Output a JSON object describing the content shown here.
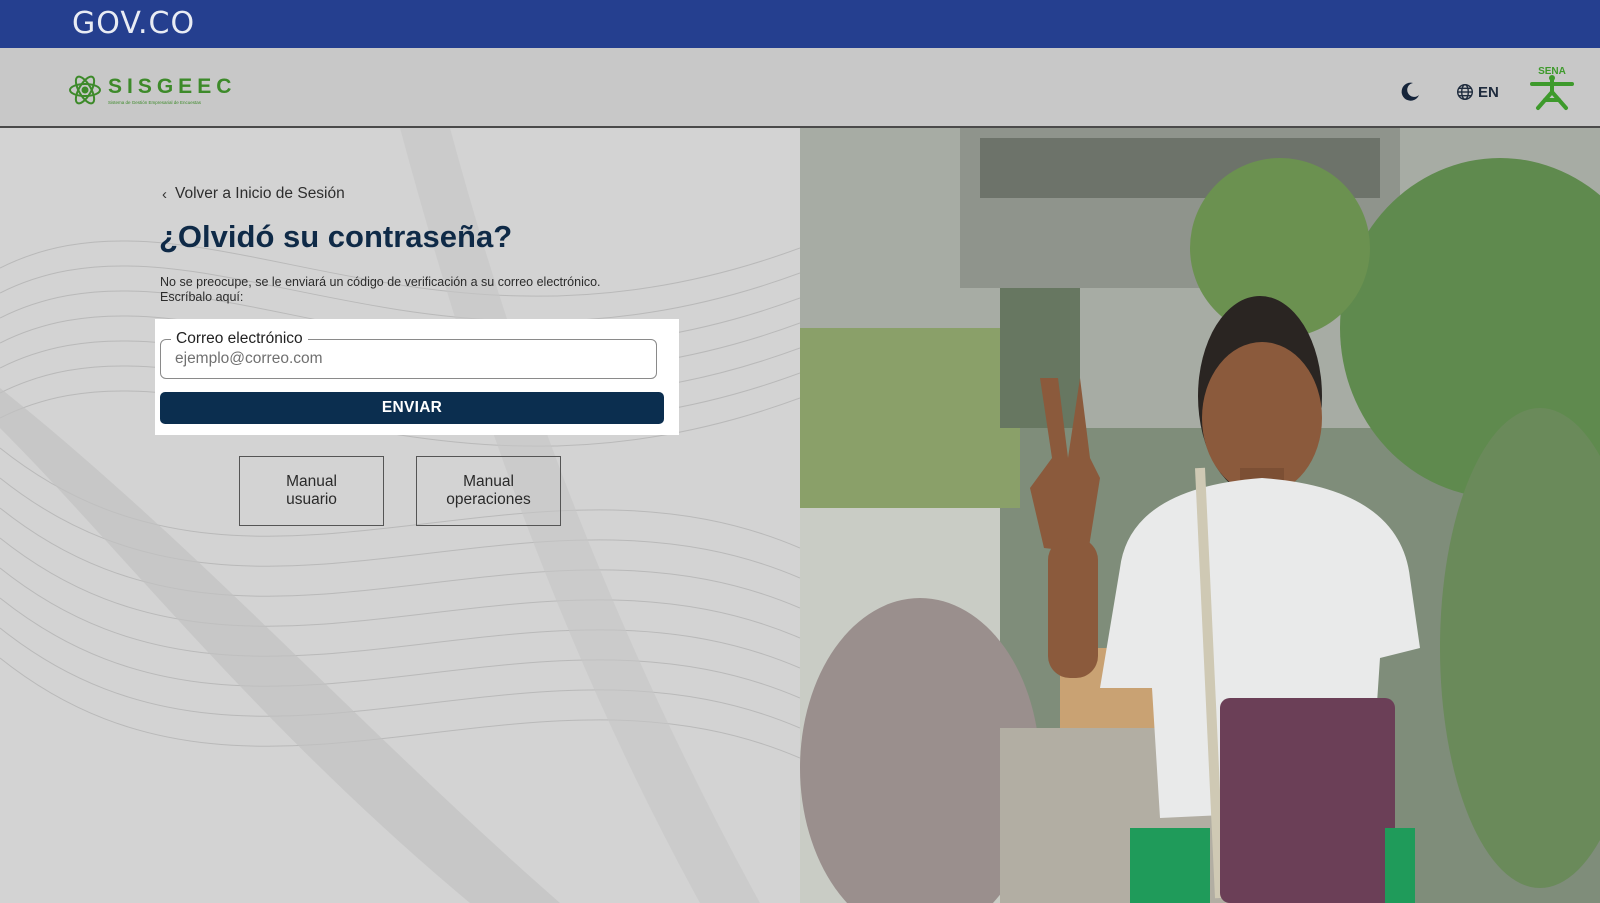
{
  "gov_bar": {
    "logo_text": "GOV.CO"
  },
  "header": {
    "brand_name": "SISGEEC",
    "brand_subtitle": "Sistema de Gestión Empresarial de Encuestas",
    "lang_label": "EN",
    "sena_text": "SENA"
  },
  "form": {
    "back_link": "Volver a Inicio de Sesión",
    "title": "¿Olvidó su contraseña?",
    "description": "No se preocupe, se le enviará un código de verificación a su correo electrónico. Escríbalo aquí:",
    "email_label": "Correo electrónico",
    "email_placeholder": "ejemplo@correo.com",
    "email_value": "",
    "submit_label": "ENVIAR"
  },
  "manuals": {
    "user": {
      "line1": "Manual",
      "line2": "usuario"
    },
    "operations": {
      "line1": "Manual",
      "line2": "operaciones"
    }
  },
  "icons": {
    "theme_toggle": "moon-icon",
    "language": "globe-icon",
    "back": "chevron-left-icon"
  },
  "colors": {
    "gov_bar": "#253f8f",
    "brand_green": "#3d8a2a",
    "primary_button": "#0b2e4f",
    "title": "#0f2a47"
  }
}
